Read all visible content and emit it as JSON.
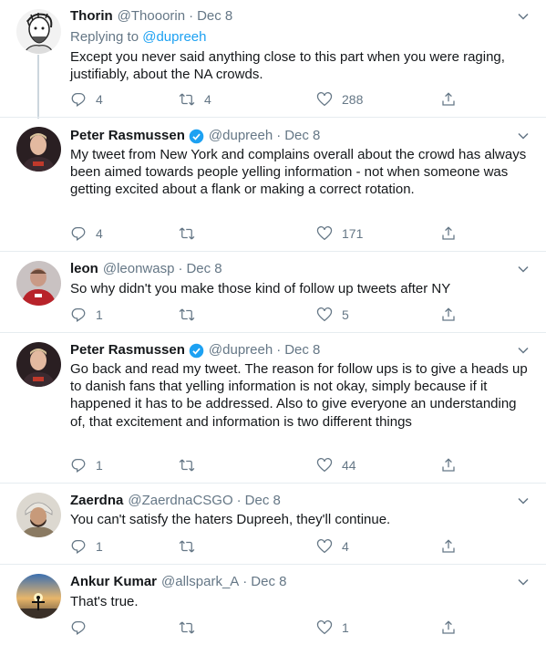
{
  "colors": {
    "accent": "#1da1f2",
    "muted": "#657786",
    "text": "#14171a",
    "divider": "#e6ecf0",
    "verified": "#1da1f2"
  },
  "tweets": [
    {
      "name": "Thorin",
      "handle": "@Thooorin",
      "dot": "·",
      "date": "Dec 8",
      "verified": false,
      "replying_prefix": "Replying to",
      "replying_to": "@dupreeh",
      "text": "Except you never said anything close to this part when you were raging, justifiably, about the NA crowds.",
      "replies": "4",
      "retweets": "4",
      "likes": "288",
      "avatar_icon": "sketch-portrait-avatar"
    },
    {
      "name": "Peter Rasmussen",
      "handle": "@dupreeh",
      "dot": "·",
      "date": "Dec 8",
      "verified": true,
      "text": "My tweet from New York and complains overall about the crowd has always been aimed towards people yelling information - not when someone was getting excited about a flank or making a correct rotation.",
      "replies": "4",
      "retweets": "",
      "likes": "171",
      "avatar_icon": "photo-avatar"
    },
    {
      "name": "leon",
      "handle": "@leonwasp",
      "dot": "·",
      "date": "Dec 8",
      "verified": false,
      "text": "So why didn't you make those kind of follow up tweets after NY",
      "replies": "1",
      "retweets": "",
      "likes": "5",
      "avatar_icon": "photo-avatar"
    },
    {
      "name": "Peter Rasmussen",
      "handle": "@dupreeh",
      "dot": "·",
      "date": "Dec 8",
      "verified": true,
      "text": "Go back and read my tweet. The reason for follow ups is to give a heads up to danish fans that yelling information is not okay, simply because if it happened it has to be addressed. Also to give everyone an understanding of, that excitement and information is two different things",
      "replies": "1",
      "retweets": "",
      "likes": "44",
      "avatar_icon": "photo-avatar"
    },
    {
      "name": "Zaerdna",
      "handle": "@ZaerdnaCSGO",
      "dot": "·",
      "date": "Dec 8",
      "verified": false,
      "text": "You can't satisfy the haters Dupreeh, they'll continue.",
      "replies": "1",
      "retweets": "",
      "likes": "4",
      "avatar_icon": "photo-avatar"
    },
    {
      "name": "Ankur Kumar",
      "handle": "@allspark_A",
      "dot": "·",
      "date": "Dec 8",
      "verified": false,
      "text": "That's true.",
      "replies": "",
      "retweets": "",
      "likes": "1",
      "avatar_icon": "photo-avatar"
    }
  ]
}
